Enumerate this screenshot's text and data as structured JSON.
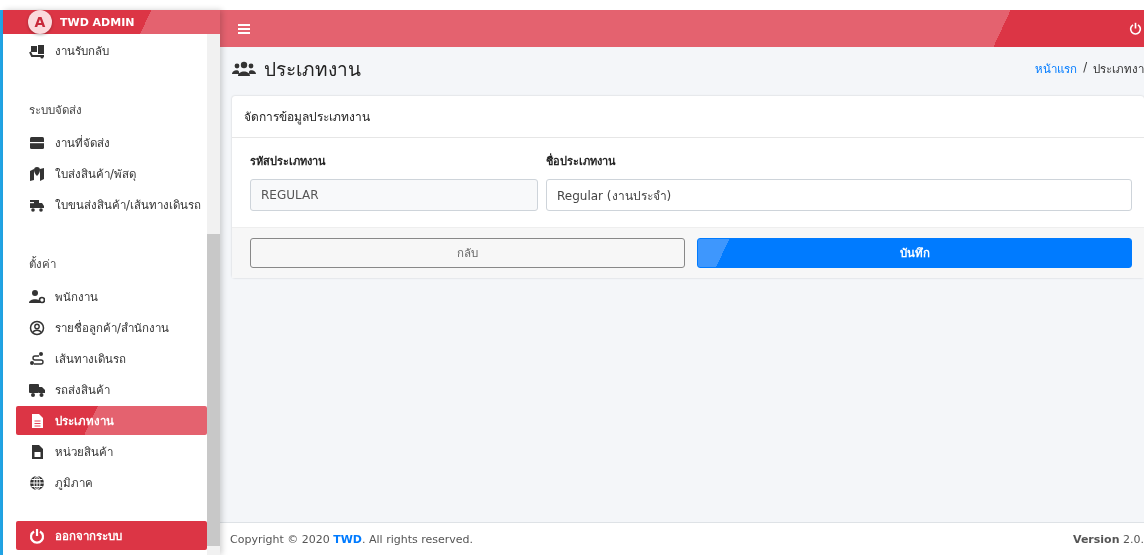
{
  "brand": {
    "title": "TWD ADMIN",
    "logo_letter": "A"
  },
  "sidebar": {
    "sections": [
      {
        "items": [
          {
            "label": "งานรับกลับ",
            "selected": false
          }
        ]
      },
      {
        "heading": "ระบบจัดส่ง",
        "items": [
          {
            "label": "งานที่จัดส่ง",
            "selected": false
          },
          {
            "label": "ใบส่งสินค้า/พัสดุ",
            "selected": false
          },
          {
            "label": "ใบขนส่งสินค้า/เส้นทางเดินรถ",
            "selected": false
          }
        ]
      },
      {
        "heading": "ตั้งค่า",
        "items": [
          {
            "label": "พนักงาน",
            "selected": false
          },
          {
            "label": "รายชื่อลูกค้า/สำนักงาน",
            "selected": false
          },
          {
            "label": "เส้นทางเดินรถ",
            "selected": false
          },
          {
            "label": "รถส่งสินค้า",
            "selected": false
          },
          {
            "label": "ประเภทงาน",
            "selected": true
          },
          {
            "label": "หน่วยสินค้า",
            "selected": false
          },
          {
            "label": "ภูมิภาค",
            "selected": false
          }
        ]
      }
    ],
    "logout": "ออกจากระบบ"
  },
  "page": {
    "title": "ประเภทงาน",
    "breadcrumb_separator": "/",
    "breadcrumb": [
      {
        "label": "หน้าแรก",
        "kind": "link"
      },
      {
        "label": "ประเภทงา",
        "kind": "current"
      }
    ]
  },
  "card": {
    "title": "จัดการข้อมูลประเภทงาน",
    "fields": [
      {
        "label": "รหัสประเภทงาน",
        "value": "REGULAR",
        "disabled": true
      },
      {
        "label": "ชื่อประเภทงาน",
        "value": "Regular (งานประจำ)",
        "disabled": false
      }
    ],
    "buttons": [
      {
        "label": "กลับ",
        "kind": "secondary"
      },
      {
        "label": "บันทึก",
        "kind": "primary"
      }
    ]
  },
  "footer": {
    "copyright_before": "Copyright © 2020 ",
    "copyright_link": "TWD",
    "copyright_after": ". All rights reserved.",
    "version": "**Version** 2.0."
  }
}
